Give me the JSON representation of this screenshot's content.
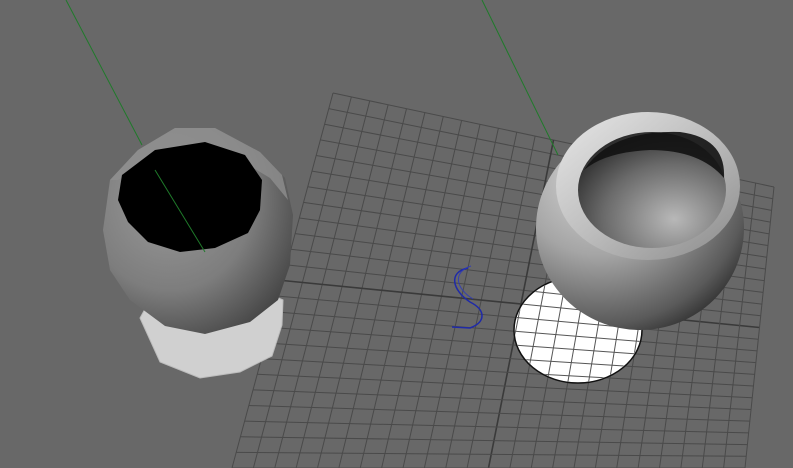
{
  "viewport": {
    "mode": "perspective-3d-viewport",
    "background_color": "#686868",
    "shading": "smooth-shaded"
  },
  "grid": {
    "visible": true,
    "line_color": "#4a4a4a",
    "axis_color": "#3a3a3a",
    "subdivisions": 24
  },
  "objects": [
    {
      "name": "low-poly-cup",
      "kind": "revolved mesh, faceted",
      "selected": false
    },
    {
      "name": "smooth-cup",
      "kind": "revolved mesh, smoothed",
      "selected": false
    },
    {
      "name": "profile-curve",
      "kind": "nurbs curve",
      "selected": true,
      "color": "#1f2aa8"
    }
  ],
  "pivot_lines_color": "#1f7a2a"
}
